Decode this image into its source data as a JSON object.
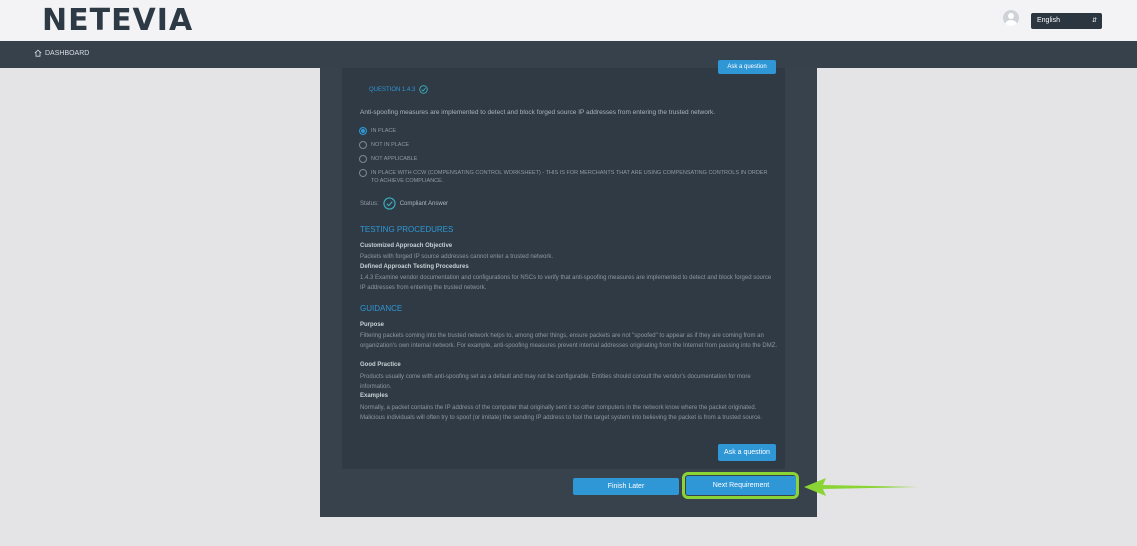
{
  "header": {
    "logo": "NETEVIA",
    "language": "English"
  },
  "nav": {
    "dashboard": "DASHBOARD"
  },
  "question": {
    "ask_label": "Ask a question",
    "number": "QUESTION 1.4.3",
    "text": "Anti-spoofing measures are implemented to detect and block forged source IP addresses from entering the trusted network.",
    "options": [
      {
        "label": "IN PLACE",
        "selected": true
      },
      {
        "label": "NOT IN PLACE",
        "selected": false
      },
      {
        "label": "NOT APPLICABLE",
        "selected": false
      },
      {
        "label": "IN PLACE WITH CCW (COMPENSATING CONTROL WORKSHEET) - THIS IS FOR MERCHANTS THAT ARE USING COMPENSATING CONTROLS IN ORDER TO ACHIEVE COMPLIANCE.",
        "selected": false
      }
    ],
    "status_label": "Status:",
    "status_value": "Compliant Answer"
  },
  "testing": {
    "heading": "TESTING PROCEDURES",
    "objective_title": "Customized Approach Objective",
    "objective_text": "Packets with forged IP source addresses cannot enter a trusted network.",
    "defined_title": "Defined Approach Testing Procedures",
    "defined_text": "1.4.3 Examine vendor documentation and configurations for NSCs to verify that anti-spoofing measures are implemented to detect and block forged source IP addresses from entering the trusted network."
  },
  "guidance": {
    "heading": "GUIDANCE",
    "purpose_title": "Purpose",
    "purpose_text": "Filtering packets coming into the trusted network helps to, among other things, ensure packets are not \"spoofed\" to appear as if they are coming from an organization's own internal network. For example, anti-spoofing measures prevent internal addresses originating from the Internet from passing into the DMZ.",
    "practice_title": "Good Practice",
    "practice_text": "Products usually come with anti-spoofing set as a default and may not be configurable. Entities should consult the vendor's documentation for more information.",
    "examples_title": "Examples",
    "examples_text": "Normally, a packet contains the IP address of the computer that originally sent it so other computers in the network know where the packet originated. Malicious individuals will often try to spoof (or imitate) the sending IP address to fool the target system into believing the packet is from a trusted source."
  },
  "actions": {
    "ask_label": "Ask a question",
    "finish_label": "Finish Later",
    "next_label": "Next Requirement"
  },
  "colors": {
    "accent": "#2f97d6",
    "highlight": "#8bd435",
    "panel": "#2f3a44",
    "navbar": "#36414b"
  }
}
